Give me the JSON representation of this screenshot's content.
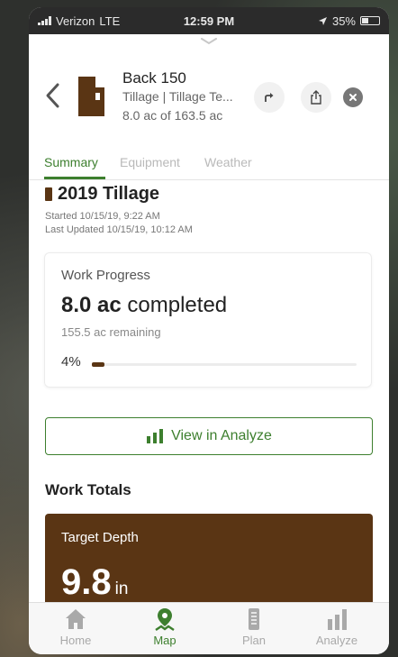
{
  "status_bar": {
    "carrier": "Verizon",
    "network": "LTE",
    "time": "12:59 PM",
    "battery": "35%"
  },
  "header": {
    "field_name": "Back 150",
    "subtitle": "Tillage | Tillage Te...",
    "area": "8.0 ac of 163.5 ac",
    "icons": [
      "back-chevron-icon",
      "field-shape-icon",
      "directions-icon",
      "share-icon",
      "close-icon"
    ]
  },
  "tabs": [
    {
      "label": "Summary",
      "active": true
    },
    {
      "label": "Equipment",
      "active": false
    },
    {
      "label": "Weather",
      "active": false
    }
  ],
  "operation": {
    "title": "2019 Tillage",
    "started": "Started 10/15/19, 9:22 AM",
    "updated": "Last Updated 10/15/19, 10:12 AM"
  },
  "progress": {
    "title": "Work Progress",
    "completed_value": "8.0 ac",
    "completed_text": "completed",
    "remaining": "155.5 ac remaining",
    "percent_label": "4%",
    "percent_value": 0.049
  },
  "analyze_button": {
    "label": "View in Analyze"
  },
  "totals": {
    "title": "Work Totals",
    "metric_label": "Target Depth",
    "metric_value": "9.8",
    "metric_unit": "in"
  },
  "nav": [
    {
      "label": "Home",
      "icon": "home-icon",
      "active": false
    },
    {
      "label": "Map",
      "icon": "map-pin-icon",
      "active": true
    },
    {
      "label": "Plan",
      "icon": "plan-icon",
      "active": false
    },
    {
      "label": "Analyze",
      "icon": "analyze-chart-icon",
      "active": false
    }
  ],
  "colors": {
    "accent_green": "#3d7f2e",
    "tillage_brown": "#5a3514"
  }
}
